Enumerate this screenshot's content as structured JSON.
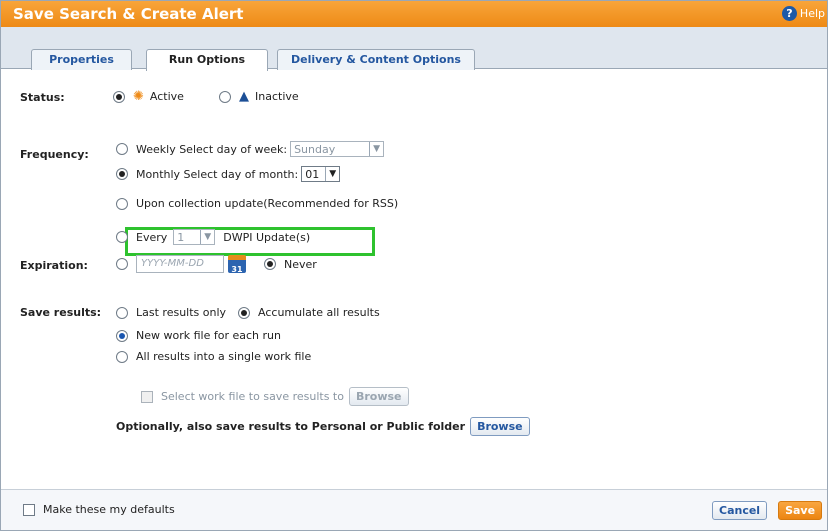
{
  "window": {
    "title": "Save Search & Create Alert",
    "help_label": "Help"
  },
  "tabs": [
    {
      "label": "Properties",
      "active": false
    },
    {
      "label": "Run Options",
      "active": true
    },
    {
      "label": "Delivery & Content Options",
      "active": false
    }
  ],
  "status": {
    "label": "Status:",
    "active_label": "Active",
    "inactive_label": "Inactive",
    "selected": "Active",
    "active_icon": "bell-icon",
    "inactive_icon": "bell-off-icon"
  },
  "frequency": {
    "label": "Frequency:",
    "weekly_label": "Weekly  Select day of week:",
    "weekly_value": "Sunday",
    "monthly_label": "Monthly Select day of month:",
    "monthly_value": "01",
    "upon_update_label": "Upon collection update(Recommended for RSS)",
    "every_label": "Every",
    "every_value": "1",
    "every_suffix": "DWPI Update(s)",
    "selected": "Monthly"
  },
  "expiration": {
    "label": "Expiration:",
    "date_placeholder": "YYYY-MM-DD",
    "calendar_text": "31",
    "never_label": "Never",
    "selected": "Never"
  },
  "save_results": {
    "label": "Save results:",
    "last_only_label": "Last results only",
    "accumulate_label": "Accumulate all results",
    "new_work_file_label": "New work file for each run",
    "single_work_file_label": "All results into a single work file",
    "select_work_file_label": "Select work file to save results to",
    "browse_label": "Browse",
    "optional_label": "Optionally, also save results to Personal or Public folder",
    "browse2_label": "Browse"
  },
  "footer": {
    "defaults_label": "Make these my defaults",
    "cancel_label": "Cancel",
    "save_label": "Save"
  },
  "colors": {
    "accent_orange": "#ee8a16",
    "link_blue": "#2457a0",
    "highlight_green": "#2ec22e"
  }
}
